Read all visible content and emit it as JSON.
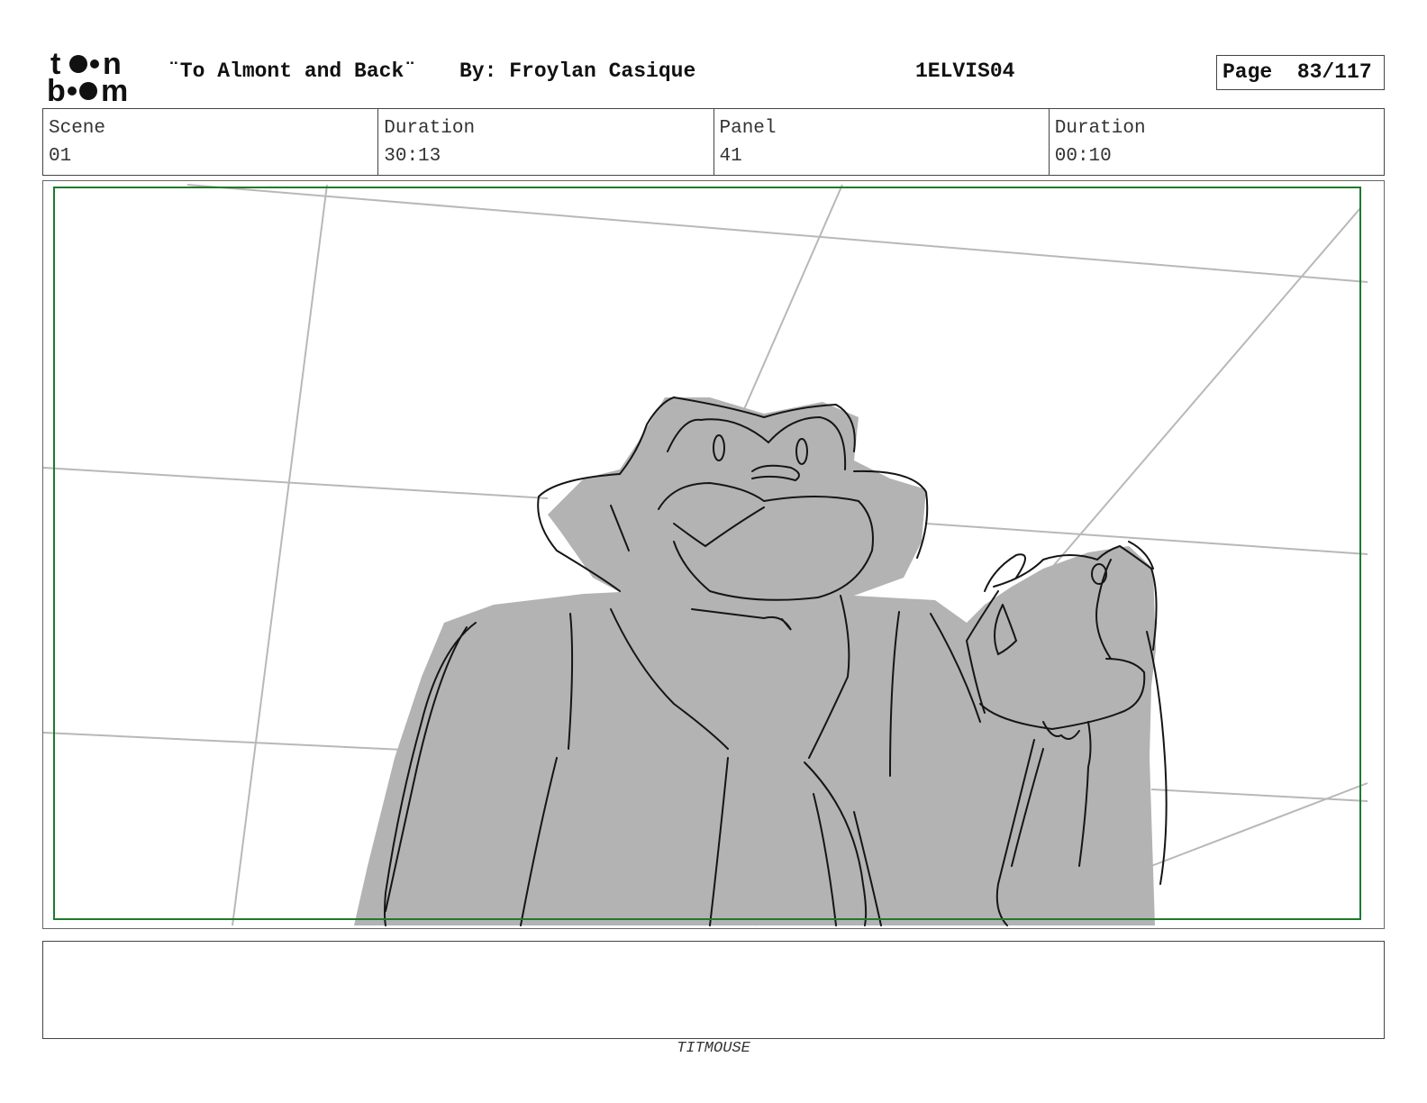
{
  "header": {
    "logo_text": "toon boom",
    "title": "¨To Almont and Back¨",
    "author": "By: Froylan Casique",
    "episode_code": "1ELVIS04",
    "page_label": "Page",
    "page_value": "83/117"
  },
  "info": {
    "scene_label": "Scene",
    "scene_value": "01",
    "duration_label": "Duration",
    "duration_value": "30:13",
    "panel_label": "Panel",
    "panel_value": "41",
    "panel_duration_label": "Duration",
    "panel_duration_value": "00:10"
  },
  "panel": {
    "safe_frame_color": "#1f7a2e",
    "fill_color": "#b3b3b3"
  },
  "notes": {
    "text": ""
  },
  "footer": {
    "studio": "TITMOUSE"
  }
}
